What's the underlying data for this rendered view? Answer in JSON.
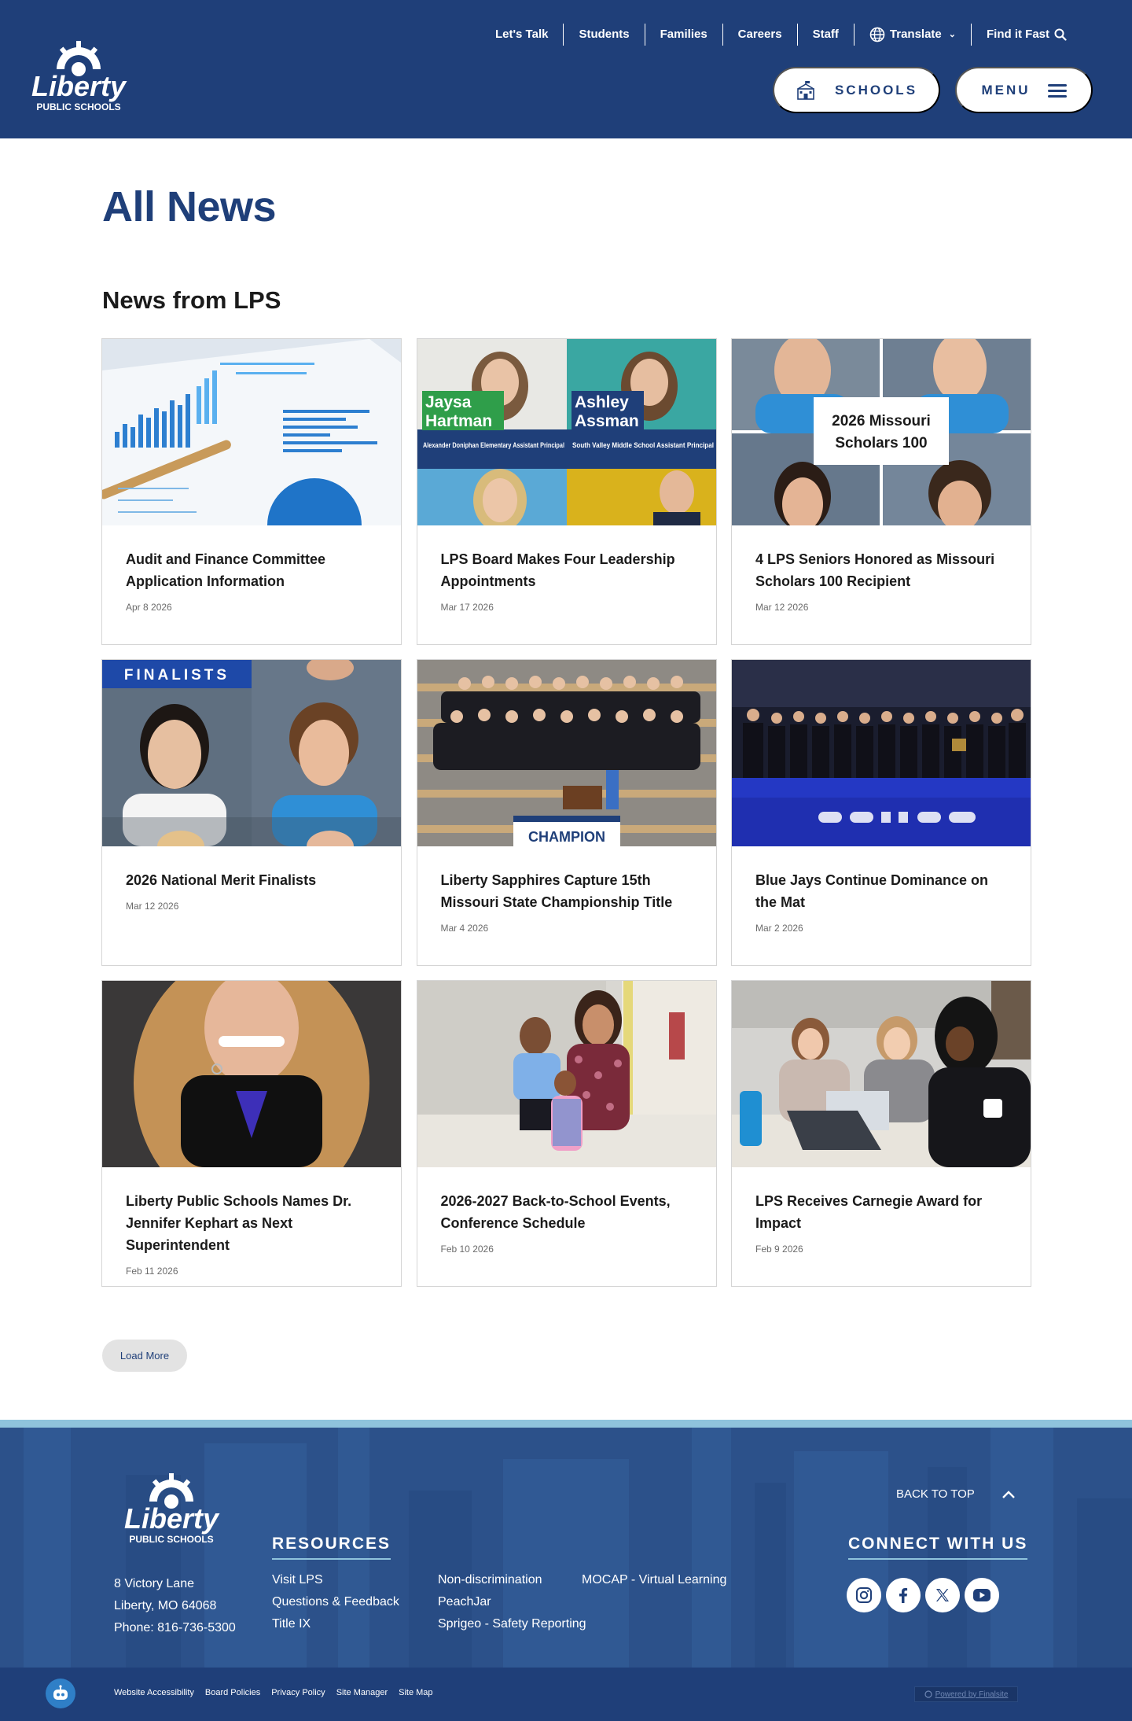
{
  "header": {
    "logo_word": "Liberty",
    "logo_sub": "PUBLIC SCHOOLS",
    "utility_links": [
      "Let's Talk",
      "Students",
      "Families",
      "Careers",
      "Staff"
    ],
    "translate_label": "Translate",
    "find_label": "Find it Fast",
    "schools_label": "SCHOOLS",
    "menu_label": "MENU"
  },
  "main": {
    "page_title": "All News",
    "section_title": "News from LPS",
    "load_more": "Load More",
    "cards": [
      {
        "title": "Audit and Finance Committee Application Information",
        "date": "Apr 8 2026"
      },
      {
        "title": "LPS Board Makes Four Leadership Appointments",
        "date": "Mar 17 2026",
        "image_text": {
          "name1_first": "Jaysa",
          "name1_last": "Hartman",
          "role1": "Alexander Doniphan Elementary Assistant Principal",
          "name2_first": "Ashley",
          "name2_last": "Assman",
          "role2": "South Valley Middle School Assistant Principal"
        }
      },
      {
        "title": "4 LPS Seniors Honored as Missouri Scholars 100 Recipient",
        "date": "Mar 12 2026",
        "image_text": {
          "line1": "2026 Missouri",
          "line2": "Scholars 100"
        }
      },
      {
        "title": "2026 National Merit Finalists",
        "date": "Mar 12 2026",
        "image_text": {
          "banner": "FINALISTS"
        }
      },
      {
        "title": "Liberty Sapphires Capture 15th Missouri State Championship Title",
        "date": "Mar 4 2026",
        "image_text": {
          "banner": "CHAMPION"
        }
      },
      {
        "title": "Blue Jays Continue Dominance on the Mat",
        "date": "Mar 2 2026"
      },
      {
        "title": "Liberty Public Schools Names Dr. Jennifer Kephart as Next Superintendent",
        "date": "Feb 11 2026"
      },
      {
        "title": "2026-2027 Back-to-School Events, Conference Schedule",
        "date": "Feb 10 2026"
      },
      {
        "title": "LPS Receives Carnegie Award for Impact",
        "date": "Feb 9 2026"
      }
    ]
  },
  "footer": {
    "address": [
      "8 Victory Lane",
      "Liberty, MO  64068",
      "Phone: 816-736-5300"
    ],
    "resources_title": "RESOURCES",
    "resources_col1": [
      "Visit LPS",
      "Questions & Feedback",
      "Title IX"
    ],
    "resources_col2": [
      "Non-discrimination",
      "PeachJar",
      "Sprigeo - Safety Reporting"
    ],
    "resources_col3": [
      "MOCAP - Virtual Learning"
    ],
    "back_to_top": "BACK TO TOP",
    "connect_title": "CONNECT WITH US",
    "social_icons": [
      "instagram-icon",
      "facebook-icon",
      "x-icon",
      "youtube-icon"
    ],
    "bottom_links": [
      "Website Accessibility",
      "Board Policies",
      "Privacy Policy",
      "Site Manager",
      "Site Map"
    ],
    "powered_by": "Powered by Finalsite"
  },
  "colors": {
    "brand_blue": "#1f3f79",
    "accent_light_blue": "#8fc3dc",
    "footer_blue": "#2c518a"
  }
}
